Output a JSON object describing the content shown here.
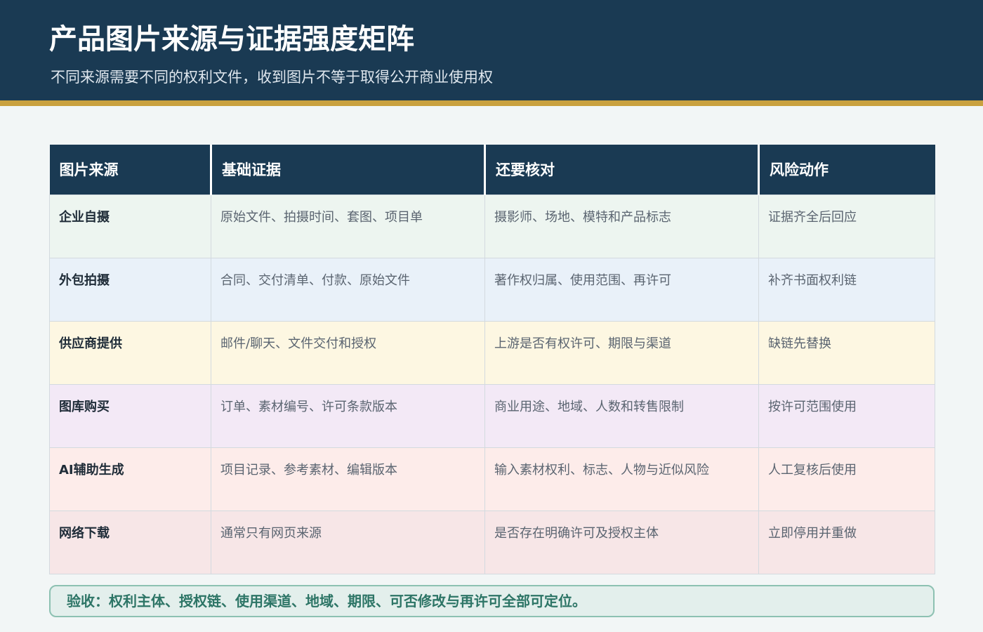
{
  "header": {
    "title": "产品图片来源与证据强度矩阵",
    "subtitle": "不同来源需要不同的权利文件，收到图片不等于取得公开商业使用权"
  },
  "table": {
    "columns": [
      "图片来源",
      "基础证据",
      "还要核对",
      "风险动作"
    ],
    "rows": [
      [
        "企业自摄",
        "原始文件、拍摄时间、套图、项目单",
        "摄影师、场地、模特和产品标志",
        "证据齐全后回应"
      ],
      [
        "外包拍摄",
        "合同、交付清单、付款、原始文件",
        "著作权归属、使用范围、再许可",
        "补齐书面权利链"
      ],
      [
        "供应商提供",
        "邮件/聊天、文件交付和授权",
        "上游是否有权许可、期限与渠道",
        "缺链先替换"
      ],
      [
        "图库购买",
        "订单、素材编号、许可条款版本",
        "商业用途、地域、人数和转售限制",
        "按许可范围使用"
      ],
      [
        "AI辅助生成",
        "项目记录、参考素材、编辑版本",
        "输入素材权利、标志、人物与近似风险",
        "人工复核后使用"
      ],
      [
        "网络下载",
        "通常只有网页来源",
        "是否存在明确许可及授权主体",
        "立即停用并重做"
      ]
    ]
  },
  "acceptance": {
    "text": "验收：权利主体、授权链、使用渠道、地域、期限、可否修改与再许可全部可定位。"
  },
  "colors": {
    "header_bg": "#1a3a53",
    "accent_stripe": "#c9a13f",
    "acceptance_text": "#2d7566"
  }
}
